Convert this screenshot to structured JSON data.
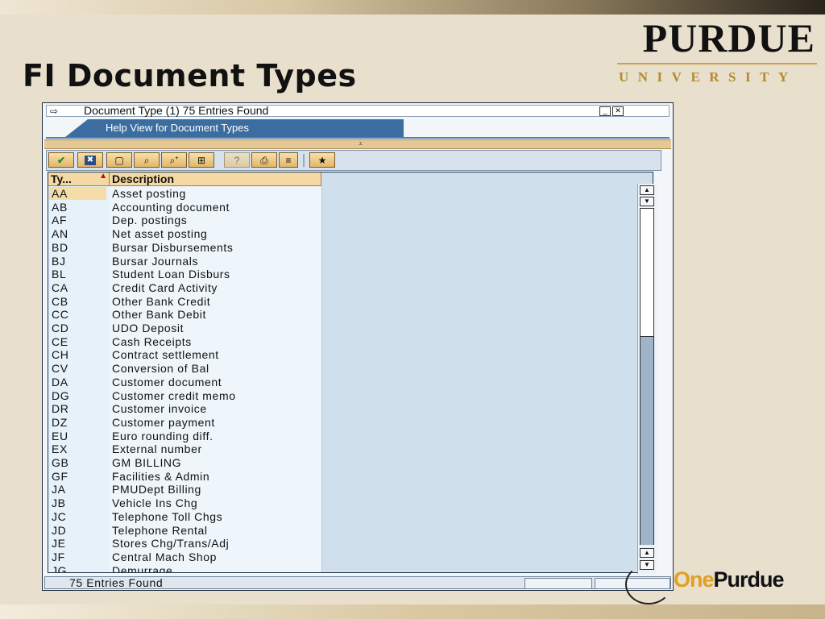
{
  "slide": {
    "title": "FI Document Types"
  },
  "logo": {
    "name": "PURDUE",
    "subtitle": "UNIVERSITY"
  },
  "footer_logo": {
    "one": "One",
    "purdue": "Purdue"
  },
  "dialog": {
    "title": "Document Type (1)   75 Entries Found",
    "tab_label": "Help View for Document Types",
    "toolbar_buttons": [
      {
        "name": "check-icon",
        "glyph": "✔"
      },
      {
        "name": "cancel-icon",
        "glyph": "✖"
      },
      {
        "name": "new-page-icon",
        "glyph": "▢"
      },
      {
        "name": "find-icon",
        "glyph": "⌕"
      },
      {
        "name": "find-next-icon",
        "glyph": "⌕+"
      },
      {
        "name": "filter-icon",
        "glyph": "⊞"
      },
      {
        "name": "help-icon",
        "glyph": "?"
      },
      {
        "name": "print-icon",
        "glyph": "⎙"
      },
      {
        "name": "list-icon",
        "glyph": "≡"
      },
      {
        "name": "personal-list-icon",
        "glyph": "★"
      }
    ],
    "columns": {
      "code": "Ty...",
      "description": "Description"
    },
    "rows": [
      {
        "code": "AA",
        "description": "Asset posting"
      },
      {
        "code": "AB",
        "description": "Accounting document"
      },
      {
        "code": "AF",
        "description": "Dep. postings"
      },
      {
        "code": "AN",
        "description": "Net asset posting"
      },
      {
        "code": "BD",
        "description": "Bursar Disbursements"
      },
      {
        "code": "BJ",
        "description": "Bursar Journals"
      },
      {
        "code": "BL",
        "description": "Student Loan Disburs"
      },
      {
        "code": "CA",
        "description": "Credit Card Activity"
      },
      {
        "code": "CB",
        "description": "Other Bank Credit"
      },
      {
        "code": "CC",
        "description": "Other Bank Debit"
      },
      {
        "code": "CD",
        "description": "UDO Deposit"
      },
      {
        "code": "CE",
        "description": "Cash Receipts"
      },
      {
        "code": "CH",
        "description": "Contract settlement"
      },
      {
        "code": "CV",
        "description": "Conversion of Bal"
      },
      {
        "code": "DA",
        "description": "Customer document"
      },
      {
        "code": "DG",
        "description": "Customer credit memo"
      },
      {
        "code": "DR",
        "description": "Customer invoice"
      },
      {
        "code": "DZ",
        "description": "Customer payment"
      },
      {
        "code": "EU",
        "description": "Euro rounding diff."
      },
      {
        "code": "EX",
        "description": "External number"
      },
      {
        "code": "GB",
        "description": "GM BILLING"
      },
      {
        "code": "GF",
        "description": "Facilities & Admin"
      },
      {
        "code": "JA",
        "description": "PMUDept Billing"
      },
      {
        "code": "JB",
        "description": "Vehicle Ins Chg"
      },
      {
        "code": "JC",
        "description": "Telephone Toll Chgs"
      },
      {
        "code": "JD",
        "description": "Telephone Rental"
      },
      {
        "code": "JE",
        "description": "Stores Chg/Trans/Adj"
      },
      {
        "code": "JF",
        "description": "Central Mach Shop"
      },
      {
        "code": "JG",
        "description": "Demurrage"
      }
    ],
    "selected_row": 0,
    "status": "75 Entries Found"
  },
  "colors": {
    "background": "#e9dfcd",
    "sap_tab": "#3b6da0",
    "header_cell": "#f4d9a4",
    "grid_bg": "#cfdfec",
    "logo_gold": "#b48a2c"
  }
}
